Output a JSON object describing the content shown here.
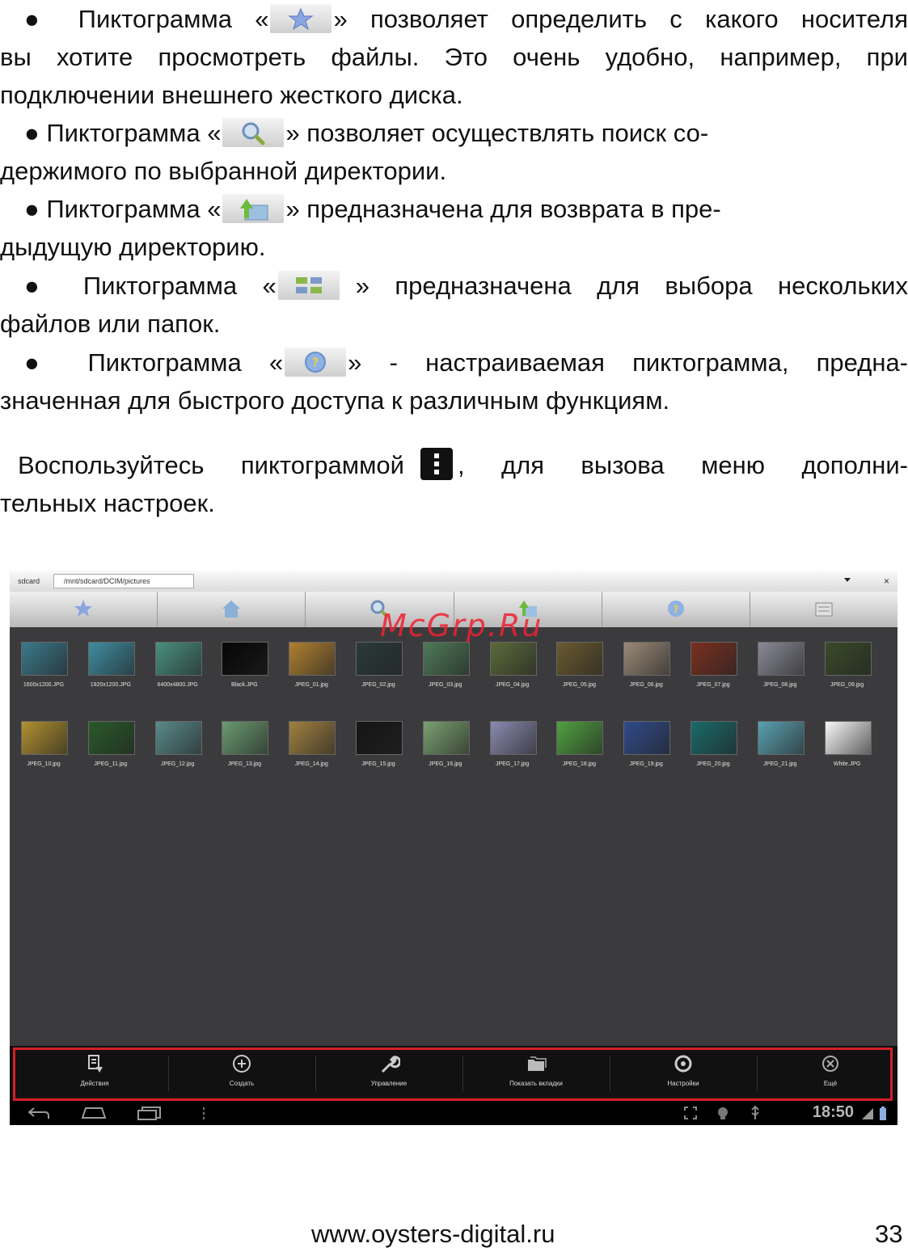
{
  "paragraphs": [
    {
      "lines": [
        {
          "a": "● Пиктограмма «",
          "b": "» позволяет определить с какого носителя"
        },
        {
          "text": "вы хотите просмотреть файлы. Это очень удобно, например, при"
        },
        {
          "text": "подключении внешнего жесткого диска."
        }
      ],
      "icon": "star-icon"
    },
    {
      "lines": [
        {
          "a": "● Пиктограмма «",
          "b": "» позволяет осуществлять поиск со-"
        },
        {
          "text": "держимого по выбранной директории."
        }
      ],
      "icon": "magnifier-icon"
    },
    {
      "lines": [
        {
          "a": "● Пиктограмма «",
          "b": "» предназначена для возврата в пре-"
        },
        {
          "text": "дыдущую директорию."
        }
      ],
      "icon": "folder-up-icon"
    },
    {
      "lines": [
        {
          "a": "● Пиктограмма «",
          "b": "» предназначена для выбора нескольких"
        },
        {
          "text": "файлов или папок."
        }
      ],
      "icon": "multi-select-icon"
    },
    {
      "lines": [
        {
          "a": "● Пиктограмма «",
          "b": "» - настраиваемая пиктограмма, предна-"
        },
        {
          "text": "значенная для быстрого доступа к различным функциям."
        }
      ],
      "icon": "help-circle-icon"
    }
  ],
  "note": {
    "a": "Воспользуйтесь пиктограммой",
    "b": ", для вызова меню дополни-",
    "c": "тельных настроек.",
    "icon": "overflow-menu-icon"
  },
  "screenshot": {
    "address": {
      "home": "sdcard",
      "path": "/mnt/sdcard/DCIM/pictures"
    },
    "toolbar_icons": [
      "star-icon",
      "home-icon",
      "magnifier-icon",
      "folder-up-icon",
      "help-circle-icon",
      "multi-select-icon"
    ],
    "files": [
      {
        "name": "1600x1200.JPG",
        "color": "#3a7a8c"
      },
      {
        "name": "1920x1200.JPG",
        "color": "#3f8da0"
      },
      {
        "name": "6400x4800.JPG",
        "color": "#4a9080"
      },
      {
        "name": "Black.JPG",
        "color": "#050505"
      },
      {
        "name": "JPEG_01.jpg",
        "color": "#b08030"
      },
      {
        "name": "JPEG_02.jpg",
        "color": "#2a3a3a"
      },
      {
        "name": "JPEG_03.jpg",
        "color": "#4e7a58"
      },
      {
        "name": "JPEG_04.jpg",
        "color": "#5b6a3a"
      },
      {
        "name": "JPEG_05.jpg",
        "color": "#6a5a30"
      },
      {
        "name": "JPEG_06.jpg",
        "color": "#9a8a78"
      },
      {
        "name": "JPEG_07.jpg",
        "color": "#7a3020"
      },
      {
        "name": "JPEG_08.jpg",
        "color": "#8a8a98"
      },
      {
        "name": "JPEG_09.jpg",
        "color": "#3a4a2a"
      },
      {
        "name": "JPEG_10.jpg",
        "color": "#b09030"
      },
      {
        "name": "JPEG_11.jpg",
        "color": "#2a5a2a"
      },
      {
        "name": "JPEG_12.jpg",
        "color": "#5a8a8a"
      },
      {
        "name": "JPEG_13.jpg",
        "color": "#6a9a70"
      },
      {
        "name": "JPEG_14.jpg",
        "color": "#a08040"
      },
      {
        "name": "JPEG_15.jpg",
        "color": "#151515"
      },
      {
        "name": "JPEG_16.jpg",
        "color": "#7aa070"
      },
      {
        "name": "JPEG_17.jpg",
        "color": "#8a8ab0"
      },
      {
        "name": "JPEG_18.jpg",
        "color": "#50a040"
      },
      {
        "name": "JPEG_19.jpg",
        "color": "#304a8a"
      },
      {
        "name": "JPEG_20.jpg",
        "color": "#1a6a6a"
      },
      {
        "name": "JPEG_21.jpg",
        "color": "#5aa0b0"
      },
      {
        "name": "White.JPG",
        "color": "#f8f8f8"
      }
    ],
    "actions": [
      {
        "label": "Действия",
        "icon": "actions-icon"
      },
      {
        "label": "Создать",
        "icon": "add-circle-icon"
      },
      {
        "label": "Управление",
        "icon": "wrench-icon"
      },
      {
        "label": "Показать вкладки",
        "icon": "folders-icon"
      },
      {
        "label": "Настройки",
        "icon": "settings-icon"
      },
      {
        "label": "Ещё",
        "icon": "more-circle-icon"
      }
    ],
    "clock": "18:50"
  },
  "watermark": "McGrp.Ru",
  "footer": {
    "url": "www.oysters-digital.ru",
    "page": "33"
  }
}
